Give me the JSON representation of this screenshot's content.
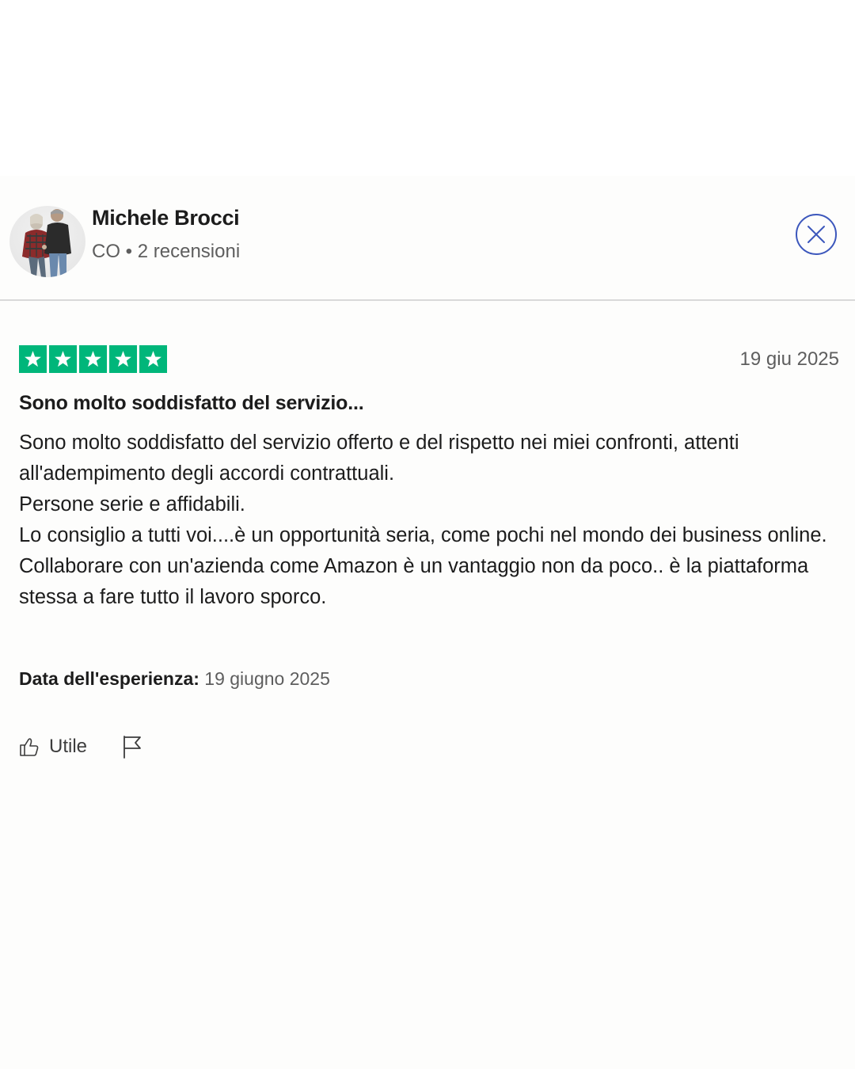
{
  "reviewer": {
    "name": "Michele Brocci",
    "country": "CO",
    "separator": "•",
    "reviews_count": "2 recensioni"
  },
  "review": {
    "rating": 5,
    "rating_max": 5,
    "date": "19 giu 2025",
    "title": "Sono molto soddisfatto del servizio...",
    "body": [
      "Sono molto soddisfatto del servizio offerto e del rispetto nei miei confronti, attenti all'adempimento degli accordi contrattuali.",
      "Persone serie e affidabili.",
      "Lo consiglio a tutti voi....è un opportunità seria, come pochi nel mondo dei business online. Collaborare con un'azienda come Amazon è un vantaggio non da poco.. è la piattaforma stessa a fare tutto il lavoro sporco."
    ],
    "experience_label": "Data dell'esperienza:",
    "experience_date": "19 giugno 2025"
  },
  "actions": {
    "useful_label": "Utile",
    "useful_icon": "thumbs-up-icon",
    "flag_icon": "flag-icon",
    "close_icon": "close-icon"
  },
  "colors": {
    "star_green": "#00b67a",
    "close_blue": "#3c57bc",
    "text_primary": "#1c1c1c",
    "text_secondary": "#5e5e5e"
  }
}
